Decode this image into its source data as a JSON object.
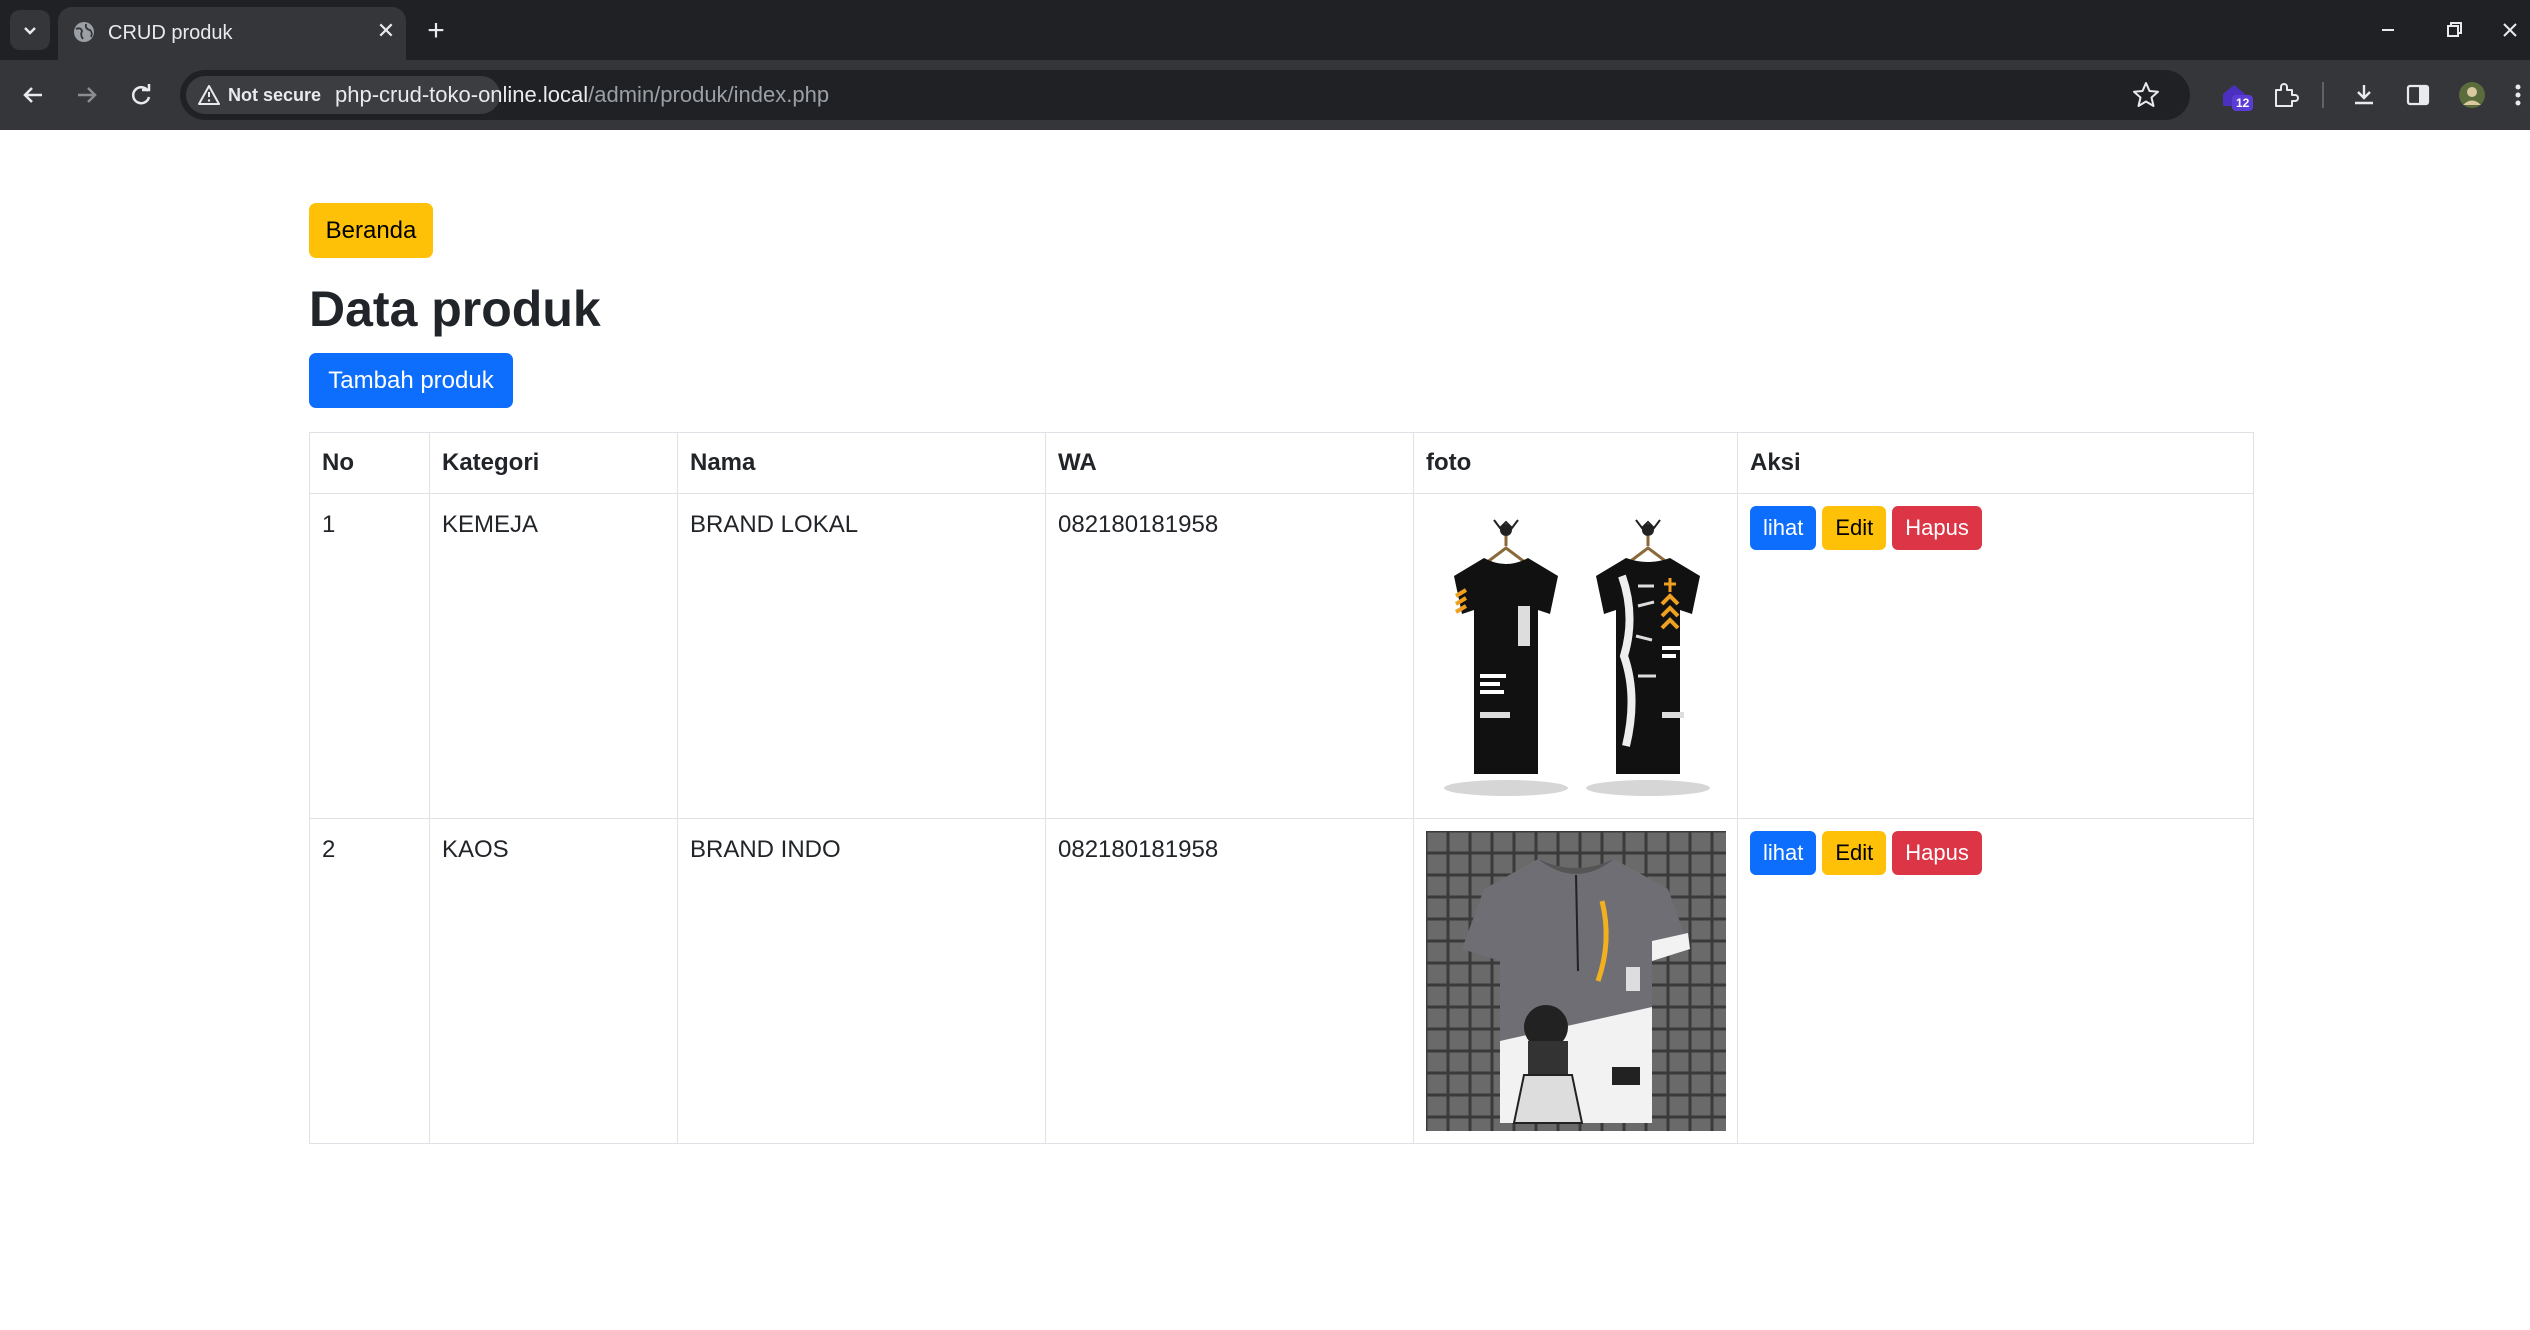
{
  "browser": {
    "tab_title": "CRUD produk",
    "security_label": "Not secure",
    "url_host": "php-crud-toko-online.local",
    "url_path": "/admin/produk/index.php",
    "extension_badge": "12"
  },
  "page": {
    "home_button": "Beranda",
    "title": "Data produk",
    "add_button": "Tambah produk"
  },
  "table": {
    "headers": [
      "No",
      "Kategori",
      "Nama",
      "WA",
      "foto",
      "Aksi"
    ],
    "rows": [
      {
        "no": "1",
        "kategori": "KEMEJA",
        "nama": "BRAND LOKAL",
        "wa": "082180181958",
        "foto": "black-tshirts-photo"
      },
      {
        "no": "2",
        "kategori": "KAOS",
        "nama": "BRAND INDO",
        "wa": "082180181958",
        "foto": "grey-tshirt-photo"
      }
    ],
    "actions": {
      "view": "lihat",
      "edit": "Edit",
      "delete": "Hapus"
    }
  },
  "colors": {
    "primary": "#0d6efd",
    "warning": "#ffc107",
    "danger": "#dc3545",
    "chrome_dark": "#202124",
    "chrome_toolbar": "#35363a"
  }
}
